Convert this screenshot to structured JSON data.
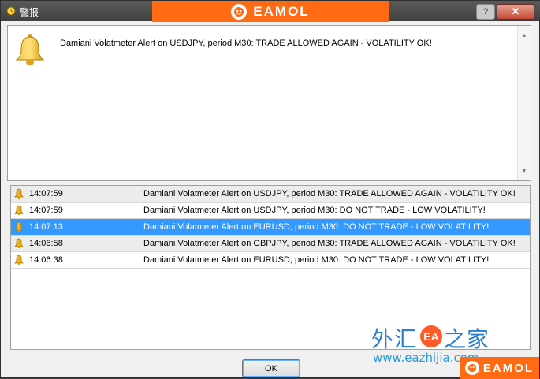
{
  "window": {
    "title": "警报",
    "close_label": "✕",
    "help_label": "?"
  },
  "brand": {
    "name": "EAMOL"
  },
  "message": {
    "text": "Damiani Volatmeter Alert on USDJPY, period M30: TRADE ALLOWED AGAIN - VOLATILITY OK!"
  },
  "alerts": [
    {
      "time": "14:07:59",
      "message": "Damiani Volatmeter Alert on USDJPY, period M30: TRADE ALLOWED AGAIN - VOLATILITY OK!"
    },
    {
      "time": "14:07:59",
      "message": "Damiani Volatmeter Alert on USDJPY, period M30: DO NOT TRADE - LOW VOLATILITY!"
    },
    {
      "time": "14:07:13",
      "message": "Damiani Volatmeter Alert on EURUSD, period M30: DO NOT TRADE - LOW VOLATILITY!"
    },
    {
      "time": "14:06:58",
      "message": "Damiani Volatmeter Alert on GBPJPY, period M30: TRADE ALLOWED AGAIN - VOLATILITY OK!"
    },
    {
      "time": "14:06:38",
      "message": "Damiani Volatmeter Alert on EURUSD, period M30: DO NOT TRADE - LOW VOLATILITY!"
    }
  ],
  "selected_alert_index": 2,
  "buttons": {
    "ok": "OK"
  },
  "watermark": {
    "chinese": "外汇",
    "chinese_tail": "之家",
    "badge": "EA",
    "url": "www.eazhijia.com"
  },
  "colors": {
    "brand_orange": "#ff6a12",
    "selection_blue": "#3399ff",
    "bell_gold": "#f2b21b"
  }
}
